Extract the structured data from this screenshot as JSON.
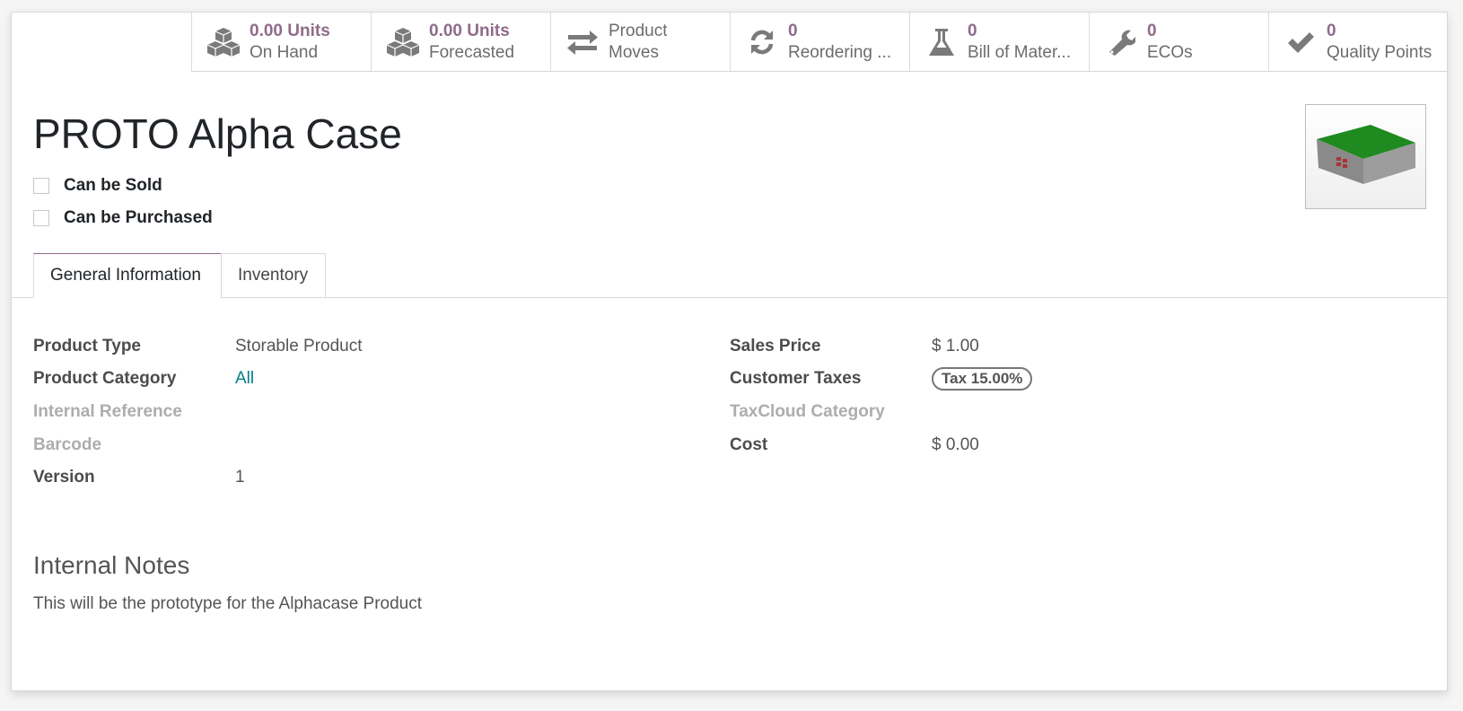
{
  "stat_buttons": [
    {
      "value": "0.00 Units",
      "label": "On Hand",
      "icon": "cubes-icon"
    },
    {
      "value": "0.00 Units",
      "label": "Forecasted",
      "icon": "cubes-icon"
    },
    {
      "value": "Product",
      "label": "Moves",
      "icon": "exchange-icon"
    },
    {
      "value": "0",
      "label": "Reordering ...",
      "icon": "refresh-icon"
    },
    {
      "value": "0",
      "label": "Bill of Mater...",
      "icon": "flask-icon"
    },
    {
      "value": "0",
      "label": "ECOs",
      "icon": "wrench-icon"
    },
    {
      "value": "0",
      "label": "Quality Points",
      "icon": "check-icon"
    }
  ],
  "product": {
    "name": "PROTO Alpha Case",
    "can_be_sold": {
      "label": "Can be Sold",
      "checked": false
    },
    "can_be_purchased": {
      "label": "Can be Purchased",
      "checked": false
    }
  },
  "tabs": [
    {
      "label": "General Information",
      "active": true
    },
    {
      "label": "Inventory",
      "active": false
    }
  ],
  "left_fields": [
    {
      "label": "Product Type",
      "value": "Storable Product"
    },
    {
      "label": "Product Category",
      "value": "All"
    },
    {
      "label": "Internal Reference",
      "value": ""
    },
    {
      "label": "Barcode",
      "value": ""
    },
    {
      "label": "Version",
      "value": "1"
    }
  ],
  "right_fields": [
    {
      "label": "Sales Price",
      "value": "$ 1.00"
    },
    {
      "label": "Customer Taxes",
      "value": "Tax 15.00%"
    },
    {
      "label": "TaxCloud Category",
      "value": ""
    },
    {
      "label": "Cost",
      "value": "$ 0.00"
    }
  ],
  "notes": {
    "heading": "Internal Notes",
    "text": "This will be the prototype for the Alphacase Product"
  },
  "colors": {
    "accent": "#8f6b8a",
    "link": "#017e84"
  }
}
